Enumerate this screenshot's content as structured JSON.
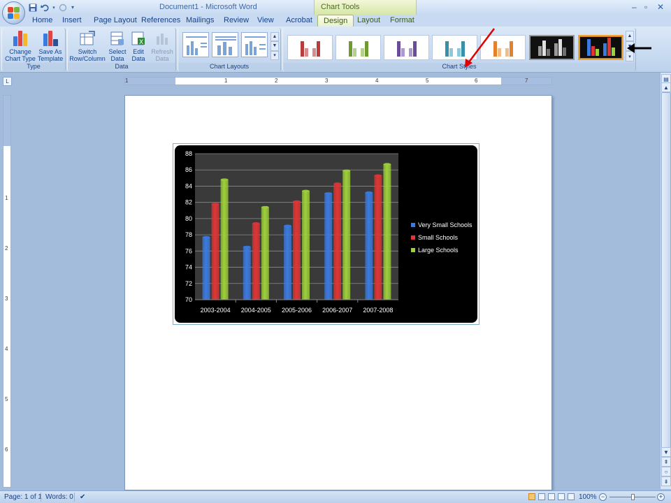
{
  "window": {
    "title": "Document1 - Microsoft Word",
    "context_group": "Chart Tools"
  },
  "tabs": [
    {
      "label": "Home"
    },
    {
      "label": "Insert"
    },
    {
      "label": "Page Layout"
    },
    {
      "label": "References"
    },
    {
      "label": "Mailings"
    },
    {
      "label": "Review"
    },
    {
      "label": "View"
    },
    {
      "label": "Acrobat"
    },
    {
      "label": "Design"
    },
    {
      "label": "Layout"
    },
    {
      "label": "Format"
    }
  ],
  "ribbon": {
    "type_group": {
      "label": "Type",
      "change_chart_type": "Change Chart Type",
      "save_as_template": "Save As Template"
    },
    "data_group": {
      "label": "Data",
      "switch_row_column": "Switch Row/Column",
      "select_data": "Select Data",
      "edit_data": "Edit Data",
      "refresh_data": "Refresh Data"
    },
    "chart_layouts": {
      "label": "Chart Layouts"
    },
    "chart_styles": {
      "label": "Chart Styles"
    }
  },
  "ruler": {
    "h_numbers": [
      "1",
      "1",
      "2",
      "3",
      "4",
      "5",
      "6",
      "7"
    ],
    "v_numbers": [
      "1",
      "2",
      "3",
      "4",
      "5",
      "6"
    ]
  },
  "chart_data": {
    "type": "bar",
    "categories": [
      "2003-2004",
      "2004-2005",
      "2005-2006",
      "2006-2007",
      "2007-2008"
    ],
    "series": [
      {
        "name": "Very Small Schools",
        "values": [
          77.7,
          76.5,
          79.1,
          83.1,
          83.2
        ],
        "color": "#3b7be0"
      },
      {
        "name": "Small Schools",
        "values": [
          81.8,
          79.4,
          82.1,
          84.3,
          85.3
        ],
        "color": "#e03535"
      },
      {
        "name": "Large Schools",
        "values": [
          84.8,
          81.4,
          83.4,
          85.9,
          86.7
        ],
        "color": "#9ed03a"
      }
    ],
    "yticks": [
      "70",
      "72",
      "74",
      "76",
      "78",
      "80",
      "82",
      "84",
      "86",
      "88"
    ],
    "ylim": [
      70,
      88
    ],
    "grid": true,
    "legend_position": "right"
  },
  "status": {
    "page": "Page: 1 of 1",
    "words": "Words: 0",
    "zoom": "100%"
  },
  "colors": {
    "accent_selection": "#f0a43a",
    "annotation_red": "#e00000",
    "annotation_black": "#000000"
  }
}
